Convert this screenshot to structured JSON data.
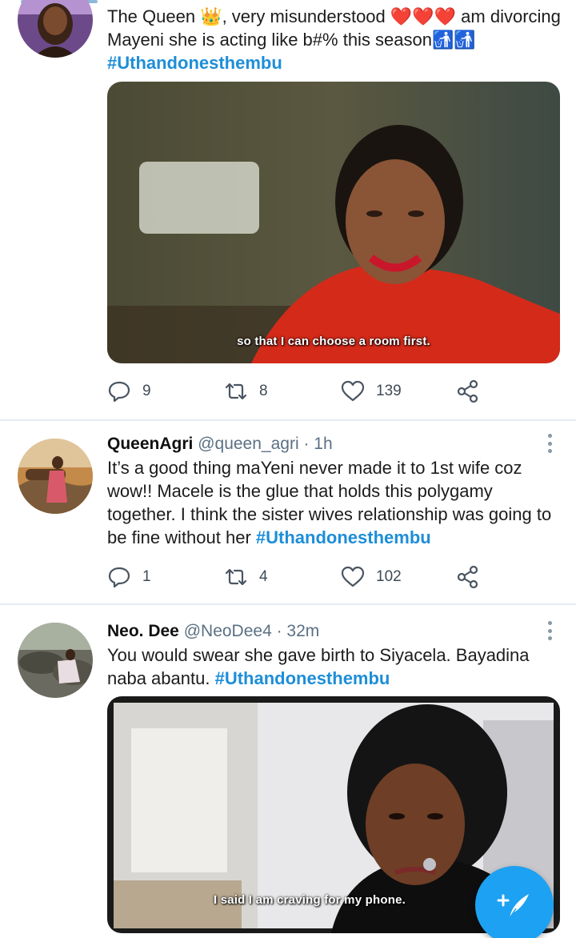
{
  "tweets": [
    {
      "text_before": "The Queen 👑, very misunderstood ❤️❤️❤️ am divorcing Mayeni she is acting like b#% this season🚮🚮",
      "hashtag": "#Uthandonesthembu",
      "media_caption": "so that I can choose a room first.",
      "replies": "9",
      "retweets": "8",
      "likes": "139"
    },
    {
      "name": "QueenAgri",
      "handle": "@queen_agri",
      "time": "· 1h",
      "text_before": "It’s a good thing maYeni never made it to 1st wife coz wow!! Macele is the glue that holds this polygamy together. I think the sister wives relationship was going to be fine without her ",
      "hashtag": "#Uthandonesthembu",
      "replies": "1",
      "retweets": "4",
      "likes": "102"
    },
    {
      "name": "Neo. Dee",
      "handle": "@NeoDee4",
      "time": "· 32m",
      "text_before": "You would swear she gave birth to Siyacela. Bayadina naba abantu. ",
      "hashtag": "#Uthandonesthembu",
      "media_caption": "I said I am craving for my phone."
    }
  ],
  "icons": {
    "reply": "reply-icon",
    "retweet": "retweet-icon",
    "like": "heart-icon",
    "share": "share-icon",
    "more": "more-vertical-icon",
    "compose": "compose-tweet-icon"
  },
  "colors": {
    "accent": "#1da1f2",
    "hashtag": "#1d8ed8",
    "divider": "#e6ecf0"
  }
}
